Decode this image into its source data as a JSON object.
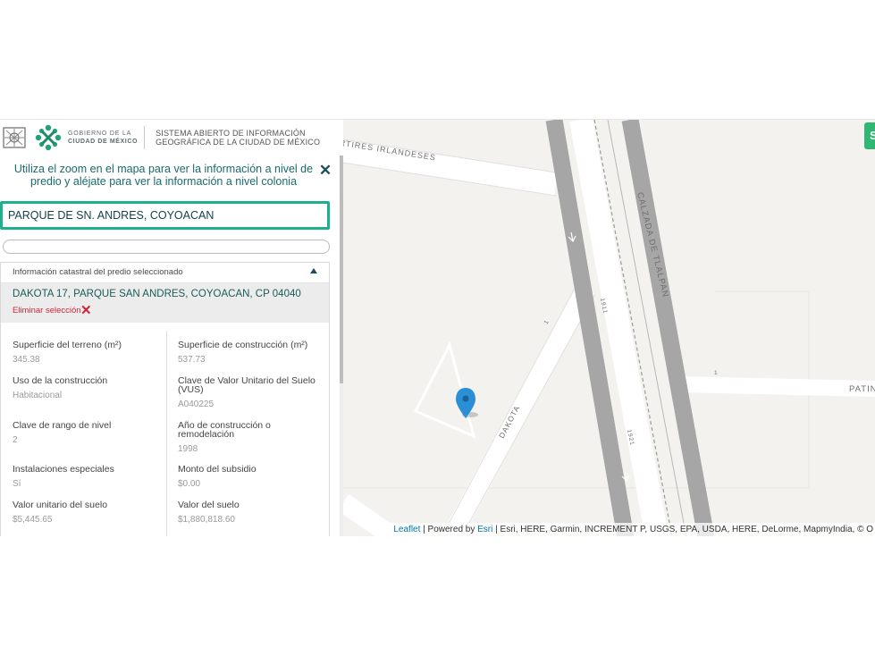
{
  "header": {
    "gov_line1": "GOBIERNO DE LA",
    "gov_line2": "CIUDAD DE MÉXICO",
    "system_line1": "SISTEMA ABIERTO DE INFORMACIÓN",
    "system_line2": "GEOGRÁFICA DE LA CIUDAD DE MÉXICO"
  },
  "panel": {
    "hint": "Utiliza el zoom en el mapa para ver la información a nivel de predio y aléjate para ver la información a nivel colonia",
    "close_icon": "close-icon",
    "search_value": "PARQUE DE SN. ANDRES, COYOACAN",
    "info_header": "Información catastral del predio seleccionado",
    "selected_address": "DAKOTA 17, PARQUE SAN ANDRES, COYOACAN, CP 04040",
    "remove_label": "Eliminar selección",
    "fields": [
      {
        "label": "Superficie del terreno (m²)",
        "value": "345.38"
      },
      {
        "label": "Superficie de construcción (m²)",
        "value": "537.73"
      },
      {
        "label": "Uso de la construcción",
        "value": "Habitacional"
      },
      {
        "label": "Clave de Valor Unitario del Suelo (VUS)",
        "value": "A040225"
      },
      {
        "label": "Clave de rango de nivel",
        "value": "2"
      },
      {
        "label": "Año de construcción o remodelación",
        "value": "1998"
      },
      {
        "label": "Instalaciones especiales",
        "value": "Sí"
      },
      {
        "label": "Monto del subsidio",
        "value": "$0.00"
      },
      {
        "label": "Valor unitario del suelo",
        "value": "$5,445.65"
      },
      {
        "label": "Valor del suelo",
        "value": "$1,880,818.60"
      }
    ]
  },
  "map": {
    "streets": {
      "martires": "MÁRTIRES IRLANDESES",
      "calzada": "CALZADA DE TLALPAN",
      "dakota": "DAKOTA",
      "patin": "PATIN"
    },
    "numbers": [
      "1",
      "1911",
      "1",
      "1921"
    ],
    "marker_icon": "map-pin-icon",
    "top_right_label": "S",
    "attribution": {
      "leaflet": "Leaflet",
      "sep1": " | Powered by ",
      "esri": "Esri",
      "rest": " | Esri, HERE, Garmin, INCREMENT P, USGS, EPA, USDA, HERE, DeLorme, MapmyIndia, © O"
    }
  },
  "colors": {
    "accent": "#1eb08d",
    "marker": "#2a8fd6",
    "danger": "#d0243b",
    "text_teal": "#1b6a6a"
  }
}
